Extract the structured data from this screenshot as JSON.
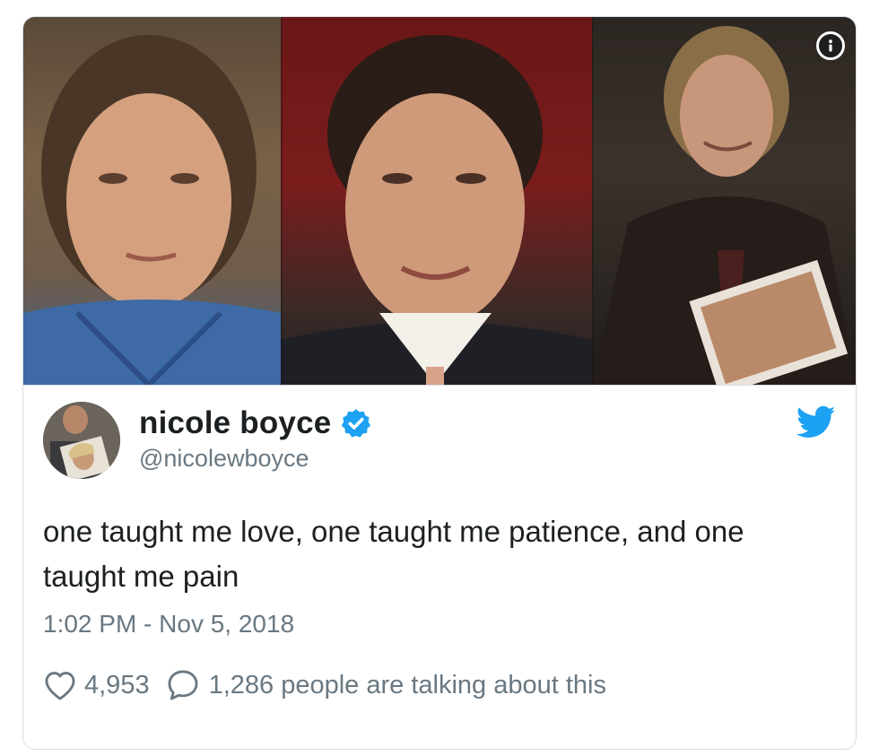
{
  "tweet": {
    "display_name": "nicole boyce",
    "handle": "@nicolewboyce",
    "text": "one taught me love, one taught me patience, and one taught me pain",
    "timestamp": "1:02 PM - Nov 5, 2018",
    "likes": "4,953",
    "conversation": "1,286 people are talking about this"
  },
  "icons": {
    "verified": "verified-badge-icon",
    "bird": "twitter-bird-icon",
    "info": "info-icon",
    "like": "heart-icon",
    "reply": "speech-bubble-icon"
  },
  "colors": {
    "twitter_blue": "#1da1f2",
    "text": "#1c2022",
    "secondary": "#697882",
    "border": "#d5dde3"
  }
}
